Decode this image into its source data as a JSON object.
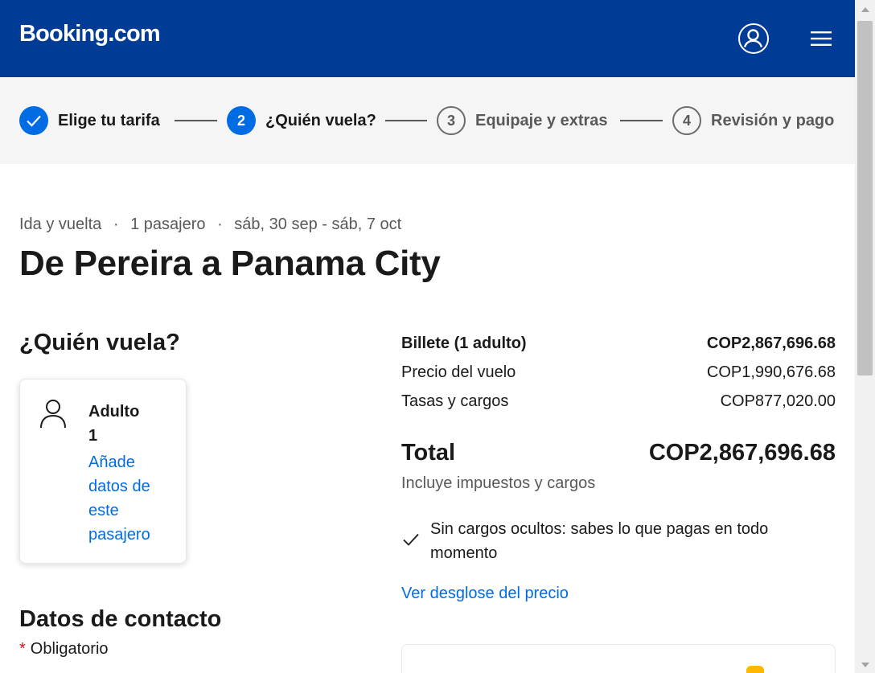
{
  "header": {
    "logo": "Booking.com",
    "account_icon": "account-icon",
    "menu_icon": "menu-icon",
    "brand_color": "#003b95"
  },
  "stepper": {
    "steps": [
      {
        "label": "Elige tu tarifa",
        "state": "done",
        "icon": "check-icon"
      },
      {
        "label": "¿Quién vuela?",
        "number": "2",
        "state": "current"
      },
      {
        "label": "Equipaje y extras",
        "number": "3",
        "state": "upcoming"
      },
      {
        "label": "Revisión y pago",
        "number": "4",
        "state": "upcoming"
      }
    ]
  },
  "trip": {
    "type": "Ida y vuelta",
    "passengers": "1 pasajero",
    "dates": "sáb, 30 sep - sáb, 7 oct",
    "separator": "·",
    "title": "De Pereira a Panama City"
  },
  "travellers": {
    "title": "¿Quién vuela?",
    "cards": [
      {
        "type": "Adulto",
        "number": "1",
        "link": "Añade datos de este pasajero",
        "icon": "person-icon"
      }
    ]
  },
  "contact": {
    "title": "Datos de contacto",
    "required_star": "*",
    "required_label": "Obligatorio"
  },
  "price": {
    "ticket_label": "Billete (1 adulto)",
    "ticket_value": "COP2,867,696.68",
    "flight_label": "Precio del vuelo",
    "flight_value": "COP1,990,676.68",
    "taxes_label": "Tasas y cargos",
    "taxes_value": "COP877,020.00",
    "total_label": "Total",
    "total_value": "COP2,867,696.68",
    "total_note": "Incluye impuestos y cargos",
    "no_hidden_fees": "Sin cargos ocultos: sabes lo que pagas en todo momento",
    "breakdown_link": "Ver desglose del precio",
    "link_color": "#006ce4"
  }
}
